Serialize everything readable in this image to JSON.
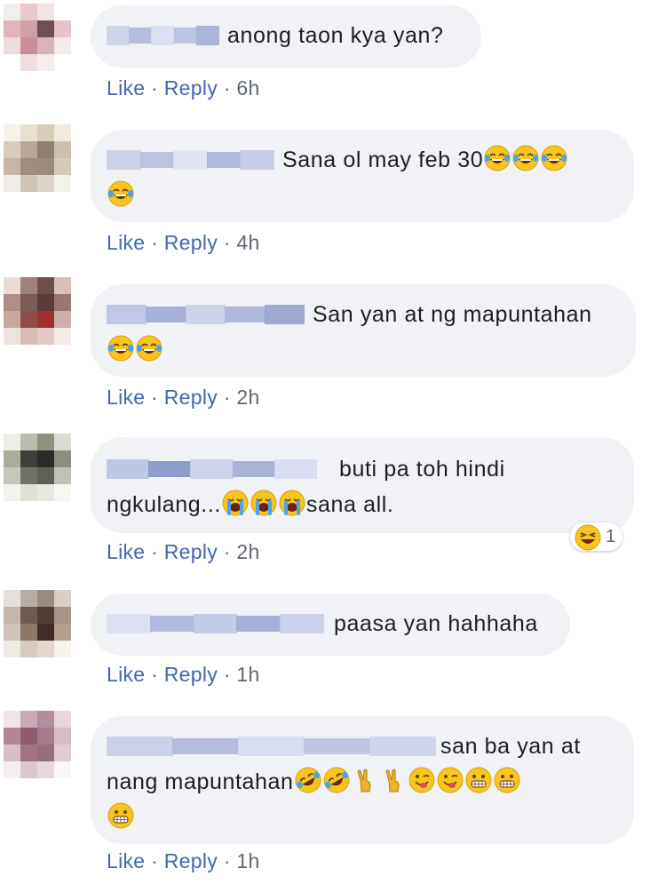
{
  "comments": [
    {
      "text_lines": [
        "anong taon kya yan?"
      ],
      "actions": {
        "like": "Like",
        "reply": "Reply",
        "time": "6h"
      },
      "avatar_colors": [
        "#f3eeee",
        "#e9c9cf",
        "#f4e2e4",
        "#ffffff",
        "#e3b3bb",
        "#cfa1a7",
        "#6e4f57",
        "#e4c4c8",
        "#eedadd",
        "#c88f98",
        "#d8b3b8",
        "#f6eaeb",
        "#ffffff",
        "#f0dde0",
        "#f7eced",
        "#ffffff"
      ],
      "name_blur_colors": [
        "#c9d0e6",
        "#a9b4d6",
        "#d7dcee",
        "#b3bddc",
        "#9eaad2"
      ]
    },
    {
      "text_lines": [
        "Sana ol may feb 30",
        ""
      ],
      "emojis_line1": [
        "face-with-tears-of-joy",
        "face-with-tears-of-joy",
        "face-with-tears-of-joy"
      ],
      "emojis_line2": [
        "face-with-tears-of-joy"
      ],
      "actions": {
        "like": "Like",
        "reply": "Reply",
        "time": "4h"
      },
      "avatar_colors": [
        "#f5f2ea",
        "#e8e1d2",
        "#d7cdb9",
        "#efe9de",
        "#d9ccbf",
        "#b9a89a",
        "#8f7e74",
        "#cdbfae",
        "#c5b6a7",
        "#a08c7e",
        "#9c8a7f",
        "#d6cabc",
        "#f0ece6",
        "#cfc4b8",
        "#ddd3c8",
        "#f4f0ea"
      ],
      "name_blur_colors": [
        "#c7cee5",
        "#b1bbdc",
        "#dde1ef",
        "#a6b1d5",
        "#c0c8e2"
      ]
    },
    {
      "text_lines": [
        "San yan at ng mapuntahan",
        ""
      ],
      "emojis_line2": [
        "face-with-tears-of-joy",
        "face-with-tears-of-joy"
      ],
      "actions": {
        "like": "Like",
        "reply": "Reply",
        "time": "2h"
      },
      "avatar_colors": [
        "#e9dbd6",
        "#a0817c",
        "#6f4f4a",
        "#d8c1ba",
        "#b08d86",
        "#7c5a55",
        "#5a3c38",
        "#9a7771",
        "#c9a7a1",
        "#8f4a4a",
        "#a0302f",
        "#c9b0aa",
        "#efe3df",
        "#d7bcb6",
        "#e2cbc6",
        "#f5ecea"
      ],
      "name_blur_colors": [
        "#b8c1e0",
        "#9aa6d1",
        "#c7cee6",
        "#a4afd6",
        "#8f9dcc"
      ]
    },
    {
      "text_lines": [
        "buti pa toh hindi",
        "ngkulang...",
        "sana all."
      ],
      "emojis_line2": [
        "loudly-crying-face",
        "loudly-crying-face",
        "loudly-crying-face"
      ],
      "reaction": {
        "icon": "laughing-reaction-icon",
        "count": "1"
      },
      "actions": {
        "like": "Like",
        "reply": "Reply",
        "time": "2h"
      },
      "avatar_colors": [
        "#eeeee6",
        "#b9bcae",
        "#8d927f",
        "#dcddd2",
        "#a9ad9a",
        "#3d3f38",
        "#2b2c27",
        "#8c8f80",
        "#c5c8b8",
        "#6f7266",
        "#5d6055",
        "#bec1b3",
        "#f3f3ee",
        "#dfe0d6",
        "#e7e8e0",
        "#f6f6f2"
      ],
      "name_blur_colors": [
        "#b5bfdf",
        "#7f8fc6",
        "#c8cfe7",
        "#9ca8d3",
        "#d6dbef"
      ]
    },
    {
      "text_lines": [
        "paasa yan hahhaha"
      ],
      "actions": {
        "like": "Like",
        "reply": "Reply",
        "time": "1h"
      },
      "avatar_colors": [
        "#e6e0db",
        "#b9aea5",
        "#9a8b80",
        "#d9cfc7",
        "#c4b6ab",
        "#6b5a50",
        "#4e3e35",
        "#a89589",
        "#d2c4ba",
        "#8c7769",
        "#3f2c24",
        "#b49e90",
        "#efe9e4",
        "#d8cbc1",
        "#e3d8cf",
        "#f5f1ed"
      ],
      "name_blur_colors": [
        "#d8ddef",
        "#a6b0d6",
        "#bcc4e1",
        "#9aa6d1",
        "#c6cde6"
      ]
    },
    {
      "text_lines": [
        "san ba yan at",
        "nang mapuntahan",
        ""
      ],
      "emojis_line2": [
        "rolling-on-floor-laughing",
        "rolling-on-floor-laughing",
        "victory-hand",
        "victory-hand",
        "winking-tongue-face",
        "winking-tongue-face",
        "grimacing-face",
        "grimacing-face"
      ],
      "emojis_line3": [
        "grimacing-face"
      ],
      "actions": {
        "like": "Like",
        "reply": "Reply",
        "time": "1h"
      },
      "avatar_colors": [
        "#efe6ea",
        "#c8a9b6",
        "#b38d9d",
        "#e7d6dd",
        "#b38796",
        "#8c5e70",
        "#a57a8a",
        "#d5bcc6",
        "#d7bfc9",
        "#a07484",
        "#94707e",
        "#e1ccd4",
        "#f5eef1",
        "#dcc6cf",
        "#e8d8de",
        "#faf5f7"
      ],
      "name_blur_colors": [
        "#c4cbe5",
        "#aab4d8",
        "#d4d9ed",
        "#b6bfdf",
        "#c9d0e8"
      ]
    }
  ]
}
